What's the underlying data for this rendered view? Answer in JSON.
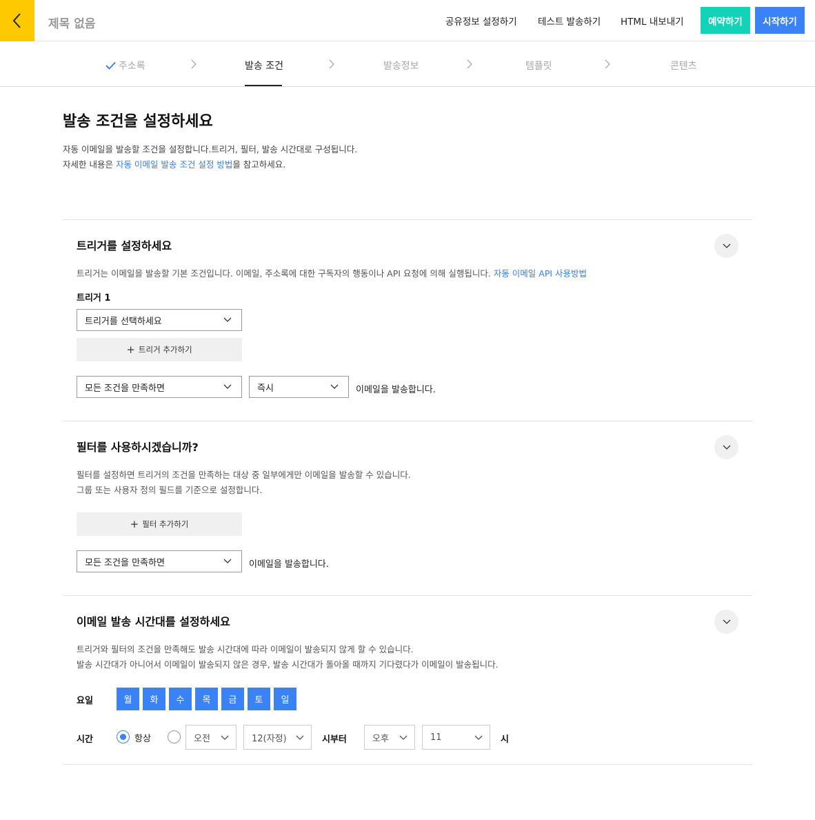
{
  "header": {
    "title": "제목 없음",
    "links": [
      "공유정보 설정하기",
      "테스트 발송하기",
      "HTML 내보내기"
    ],
    "reserve_label": "예약하기",
    "start_label": "시작하기"
  },
  "steps": [
    "주소록",
    "발송 조건",
    "발송정보",
    "템플릿",
    "콘텐츠"
  ],
  "intro": {
    "title": "발송 조건을 설정하세요",
    "line1": "자동 이메일을 발송할 조건을 설정합니다.트리거, 필터, 발송 시간대로 구성됩니다.",
    "line2_prefix": "자세한 내용은 ",
    "line2_link": "자동 이메일 발송 조건 설정 방법",
    "line2_suffix": "을 참고하세요."
  },
  "trigger": {
    "title": "트리거를 설정하세요",
    "desc": "트리거는 이메일을 발송할 기본 조건입니다. 이메일, 주소록에 대한 구독자의 행동이나 API 요청에 의해 실행됩니다. ",
    "desc_link": "자동 이메일 API 사용방법",
    "trigger_label": "트리거 1",
    "trigger_select": "트리거를 선택하세요",
    "add_label": "트리거 추가하기",
    "condition_select": "모든 조건을 만족하면",
    "timing_select": "즉시",
    "send_text": "이메일을 발송합니다."
  },
  "filter": {
    "title": "필터를 사용하시겠습니까?",
    "desc1": "필터를 설정하면 트리거의 조건을 만족하는 대상 중 일부에게만 이메일을 발송할 수 있습니다.",
    "desc2": "그룹 또는 사용자 정의 필드를 기준으로 설정합니다.",
    "add_label": "필터 추가하기",
    "condition_select": "모든 조건을 만족하면",
    "send_text": "이메일을 발송합니다."
  },
  "schedule": {
    "title": "이메일 발송 시간대를 설정하세요",
    "desc1": "트리거와 필터의 조건을 만족해도 발송 시간대에 따라 이메일이 발송되지 않게 할 수 있습니다.",
    "desc2": "발송 시간대가 아니어서 이메일이 발송되지 않은 경우, 발송 시간대가 돌아올 때까지 기다렸다가 이메일이 발송됩니다.",
    "day_label": "요일",
    "days": [
      "월",
      "화",
      "수",
      "목",
      "금",
      "토",
      "일"
    ],
    "time_label": "시간",
    "always_label": "항상",
    "start_ampm": "오전",
    "start_hour": "12(자정)",
    "from_label": "시부터",
    "end_ampm": "오후",
    "end_hour": "11",
    "until_label": "시"
  },
  "colors": {
    "back_button": "#ffc900",
    "reserve_button": "#12d3b8",
    "start_button": "#3b82f6",
    "link": "#3b7ddd",
    "day_button": "#3b82f6"
  }
}
